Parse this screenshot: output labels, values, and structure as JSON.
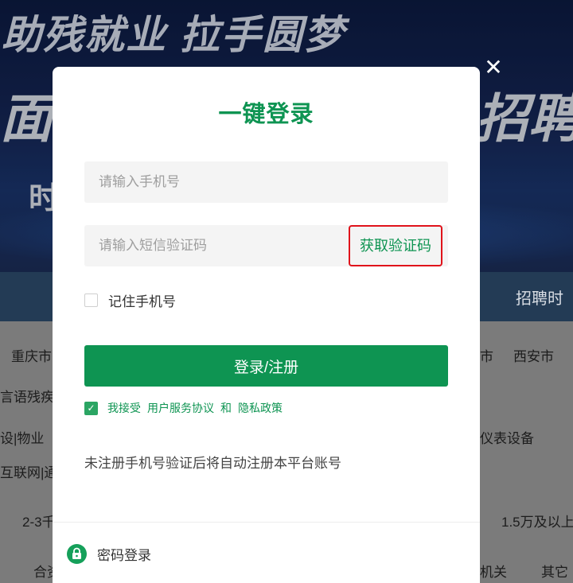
{
  "background": {
    "banner_slogan": "助残就业  拉手圆梦",
    "banner_left_fragment": "面",
    "banner_right_fragment": "招聘",
    "banner_small_fragment": "时",
    "nav_right_fragment": "招聘时",
    "content_fragments": {
      "city1": "重庆市",
      "city_right_partial": "市",
      "city2": "西安市",
      "sign_language": "言语残疾",
      "property": "设|物业",
      "instruments": "仪表设备",
      "internet": "互联网|通",
      "salary1": "2-3千",
      "salary2": "1.5万及以上",
      "coop": "合资",
      "agency": "机关",
      "other": "其它"
    }
  },
  "modal": {
    "title": "一键登录",
    "close_glyph": "✕",
    "phone_placeholder": "请输入手机号",
    "code_placeholder": "请输入短信验证码",
    "get_code_label": "获取验证码",
    "remember_label": "记住手机号",
    "remember_checked": false,
    "login_button_label": "登录/注册",
    "agree_checked": true,
    "agree_prefix": "我接受",
    "agree_terms_link": "用户服务协议",
    "agree_and": "和",
    "agree_privacy_link": "隐私政策",
    "notice_text": "未注册手机号验证后将自动注册本平台账号",
    "password_login_label": "密码登录"
  },
  "colors": {
    "brand_green": "#0e9452",
    "highlight_red": "#e0131b"
  }
}
